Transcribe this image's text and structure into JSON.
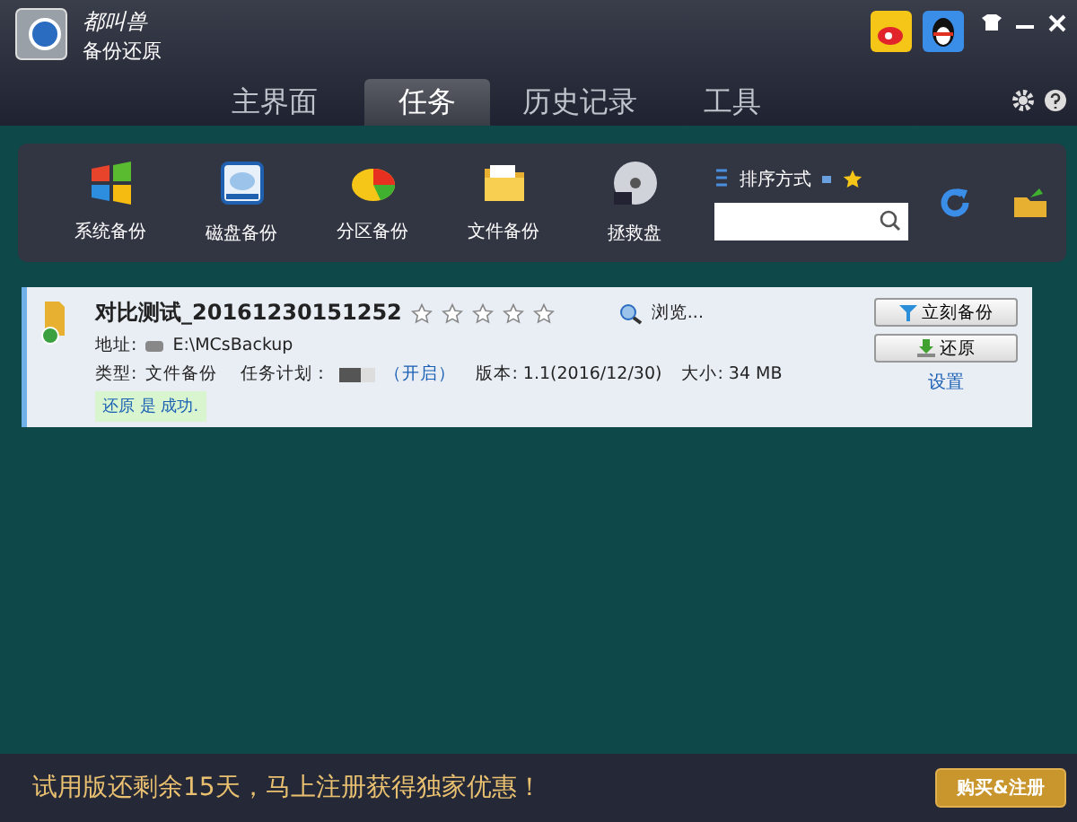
{
  "app": {
    "logo_text": "都叫兽",
    "subtitle": "备份还原"
  },
  "tabs": [
    {
      "label": "主界面",
      "selected": false
    },
    {
      "label": "任务",
      "selected": true
    },
    {
      "label": "历史记录",
      "selected": false
    },
    {
      "label": "工具",
      "selected": false
    }
  ],
  "toolbar": {
    "tools": [
      {
        "label": "系统备份",
        "kind": "windows"
      },
      {
        "label": "磁盘备份",
        "kind": "disk"
      },
      {
        "label": "分区备份",
        "kind": "pie"
      },
      {
        "label": "文件备份",
        "kind": "folder"
      },
      {
        "label": "拯救盘",
        "kind": "cd"
      }
    ],
    "sort_label": "排序方式"
  },
  "task": {
    "name": "对比测试_20161230151252",
    "stars": 0,
    "browse": "浏览...",
    "address_label": "地址:",
    "address": "E:\\MCsBackup",
    "type_label": "类型:",
    "type": "文件备份",
    "schedule_label": "任务计划：",
    "schedule_link": "（开启）",
    "version": "版本: 1.1(2016/12/30)",
    "size": "大小: 34 MB",
    "status": "还原 是 成功.",
    "buttons": [
      "立刻备份",
      "还原"
    ],
    "settings": "设置"
  },
  "footer": {
    "message": "试用版还剩余15天，马上注册获得独家优惠！",
    "button": "购买&注册"
  }
}
